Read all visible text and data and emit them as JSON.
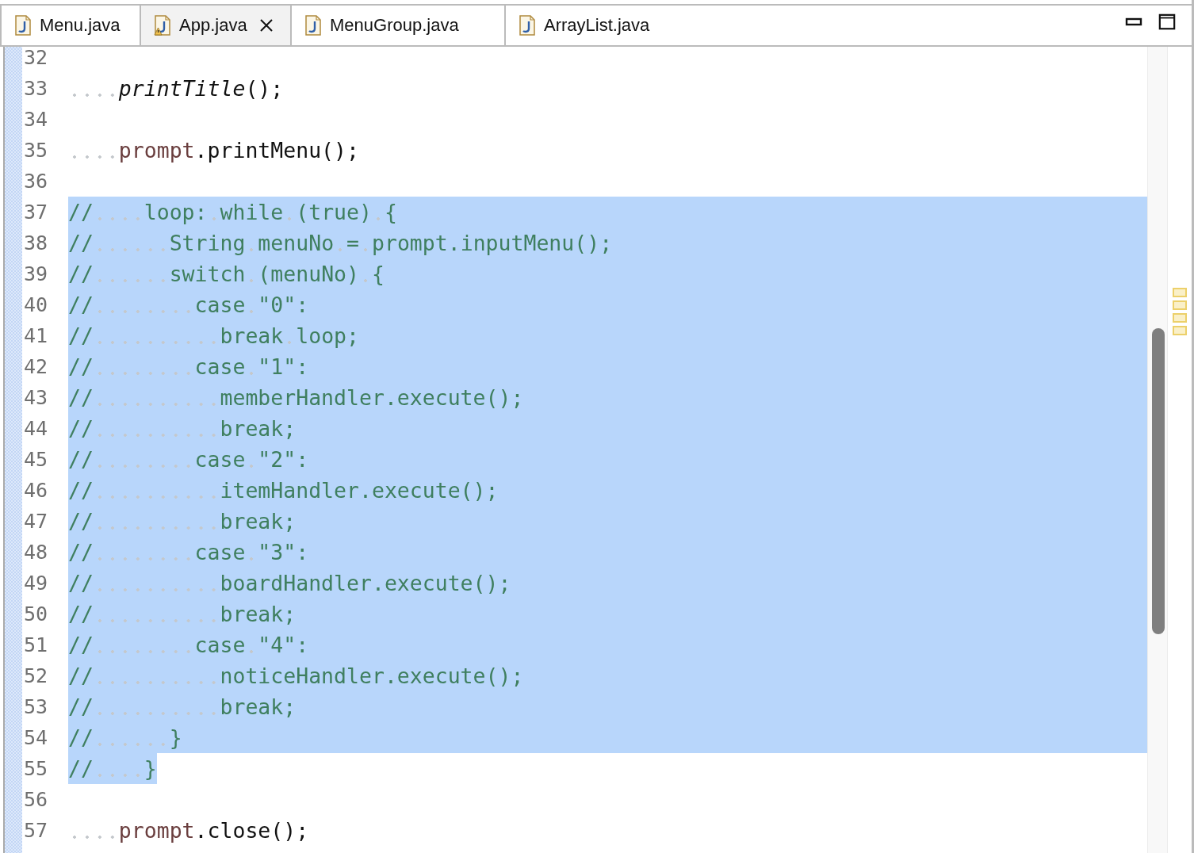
{
  "tabs": [
    {
      "label": "Menu.java",
      "selected": false,
      "warning": false
    },
    {
      "label": "App.java",
      "selected": true,
      "warning": true
    },
    {
      "label": "MenuGroup.java",
      "selected": false,
      "warning": false
    },
    {
      "label": "ArrayList.java",
      "selected": false,
      "warning": false
    }
  ],
  "lines": [
    {
      "number": "32",
      "selected": false
    },
    {
      "number": "33",
      "selected": false,
      "segments": [
        {
          "kind": "static-call",
          "text": "    printTitle"
        },
        {
          "kind": "code",
          "text": "();"
        }
      ]
    },
    {
      "number": "34",
      "selected": false
    },
    {
      "number": "35",
      "selected": false,
      "segments": [
        {
          "kind": "field",
          "text": "    prompt"
        },
        {
          "kind": "code",
          "text": ".printMenu();"
        }
      ]
    },
    {
      "number": "36",
      "selected": false
    },
    {
      "number": "37",
      "selected": true,
      "segments": [
        {
          "kind": "comment",
          "text": "//    loop: while (true) {"
        }
      ]
    },
    {
      "number": "38",
      "selected": true,
      "segments": [
        {
          "kind": "comment",
          "text": "//      String menuNo = prompt.inputMenu();"
        }
      ]
    },
    {
      "number": "39",
      "selected": true,
      "segments": [
        {
          "kind": "comment",
          "text": "//      switch (menuNo) {"
        }
      ]
    },
    {
      "number": "40",
      "selected": true,
      "segments": [
        {
          "kind": "comment",
          "text": "//        case \"0\":"
        }
      ]
    },
    {
      "number": "41",
      "selected": true,
      "segments": [
        {
          "kind": "comment",
          "text": "//          break loop;"
        }
      ]
    },
    {
      "number": "42",
      "selected": true,
      "segments": [
        {
          "kind": "comment",
          "text": "//        case \"1\":"
        }
      ]
    },
    {
      "number": "43",
      "selected": true,
      "segments": [
        {
          "kind": "comment",
          "text": "//          memberHandler.execute();"
        }
      ]
    },
    {
      "number": "44",
      "selected": true,
      "segments": [
        {
          "kind": "comment",
          "text": "//          break;"
        }
      ]
    },
    {
      "number": "45",
      "selected": true,
      "segments": [
        {
          "kind": "comment",
          "text": "//        case \"2\":"
        }
      ]
    },
    {
      "number": "46",
      "selected": true,
      "segments": [
        {
          "kind": "comment",
          "text": "//          itemHandler.execute();"
        }
      ]
    },
    {
      "number": "47",
      "selected": true,
      "segments": [
        {
          "kind": "comment",
          "text": "//          break;"
        }
      ]
    },
    {
      "number": "48",
      "selected": true,
      "segments": [
        {
          "kind": "comment",
          "text": "//        case \"3\":"
        }
      ]
    },
    {
      "number": "49",
      "selected": true,
      "segments": [
        {
          "kind": "comment",
          "text": "//          boardHandler.execute();"
        }
      ]
    },
    {
      "number": "50",
      "selected": true,
      "segments": [
        {
          "kind": "comment",
          "text": "//          break;"
        }
      ]
    },
    {
      "number": "51",
      "selected": true,
      "segments": [
        {
          "kind": "comment",
          "text": "//        case \"4\":"
        }
      ]
    },
    {
      "number": "52",
      "selected": true,
      "segments": [
        {
          "kind": "comment",
          "text": "//          noticeHandler.execute();"
        }
      ]
    },
    {
      "number": "53",
      "selected": true,
      "segments": [
        {
          "kind": "comment",
          "text": "//          break;"
        }
      ]
    },
    {
      "number": "54",
      "selected": true,
      "segments": [
        {
          "kind": "comment",
          "text": "//      }"
        }
      ]
    },
    {
      "number": "55",
      "selected": true,
      "segments": [
        {
          "kind": "comment",
          "text": "//    }"
        }
      ]
    },
    {
      "number": "56",
      "selected": false
    },
    {
      "number": "57",
      "selected": false,
      "segments": [
        {
          "kind": "field",
          "text": "    prompt"
        },
        {
          "kind": "code",
          "text": ".close();"
        }
      ]
    }
  ]
}
